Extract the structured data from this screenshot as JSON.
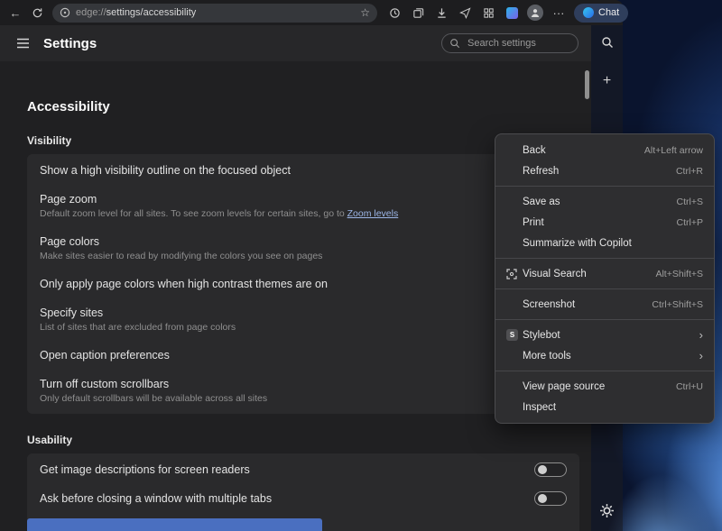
{
  "browser": {
    "url_scheme": "edge://",
    "url_path": "settings/accessibility",
    "chat_label": "Chat",
    "toolbar_icons": [
      "back-icon",
      "refresh-icon",
      "site-info-icon",
      "favorite-star-icon",
      "history-icon",
      "collections-icon",
      "downloads-icon",
      "send-icon",
      "workspaces-icon",
      "extension-icon",
      "profile-avatar",
      "more-menu-icon",
      "chat-icon"
    ],
    "sidebar_icons": [
      "search-icon",
      "add-icon",
      "gear-icon"
    ]
  },
  "header": {
    "title": "Settings",
    "search_placeholder": "Search settings"
  },
  "page": {
    "title": "Accessibility",
    "sections": [
      {
        "label": "Visibility",
        "rows": [
          {
            "title": "Show a high visibility outline on the focused object"
          },
          {
            "title": "Page zoom",
            "subtitle": "Default zoom level for all sites. To see zoom levels for certain sites, go to ",
            "link": "Zoom levels"
          },
          {
            "title": "Page colors",
            "subtitle": "Make sites easier to read by modifying the colors you see on pages"
          },
          {
            "title": "Only apply page colors when high contrast themes are on"
          },
          {
            "title": "Specify sites",
            "subtitle": "List of sites that are excluded from page colors"
          },
          {
            "title": "Open caption preferences"
          },
          {
            "title": "Turn off custom scrollbars",
            "subtitle": "Only default scrollbars will be available across all sites"
          }
        ]
      },
      {
        "label": "Usability",
        "rows": [
          {
            "title": "Get image descriptions for screen readers",
            "toggle": "off"
          },
          {
            "title": "Ask before closing a window with multiple tabs",
            "toggle": "off"
          }
        ]
      }
    ],
    "colors": {
      "link": "#9db7e8",
      "focus_highlight": "#4a6fc0"
    }
  },
  "context_menu": {
    "items": [
      {
        "label": "Back",
        "shortcut": "Alt+Left arrow"
      },
      {
        "label": "Refresh",
        "shortcut": "Ctrl+R"
      },
      {
        "type": "separator"
      },
      {
        "label": "Save as",
        "shortcut": "Ctrl+S"
      },
      {
        "label": "Print",
        "shortcut": "Ctrl+P"
      },
      {
        "label": "Summarize with Copilot"
      },
      {
        "type": "separator"
      },
      {
        "label": "Visual Search",
        "shortcut": "Alt+Shift+S",
        "icon": "visual-search-icon"
      },
      {
        "type": "separator"
      },
      {
        "label": "Screenshot",
        "shortcut": "Ctrl+Shift+S"
      },
      {
        "type": "separator"
      },
      {
        "label": "Stylebot",
        "icon": "stylebot-icon",
        "submenu": true
      },
      {
        "label": "More tools",
        "submenu": true
      },
      {
        "type": "separator"
      },
      {
        "label": "View page source",
        "shortcut": "Ctrl+U"
      },
      {
        "label": "Inspect"
      }
    ],
    "icons": {
      "stylebot_badge": "S"
    }
  }
}
